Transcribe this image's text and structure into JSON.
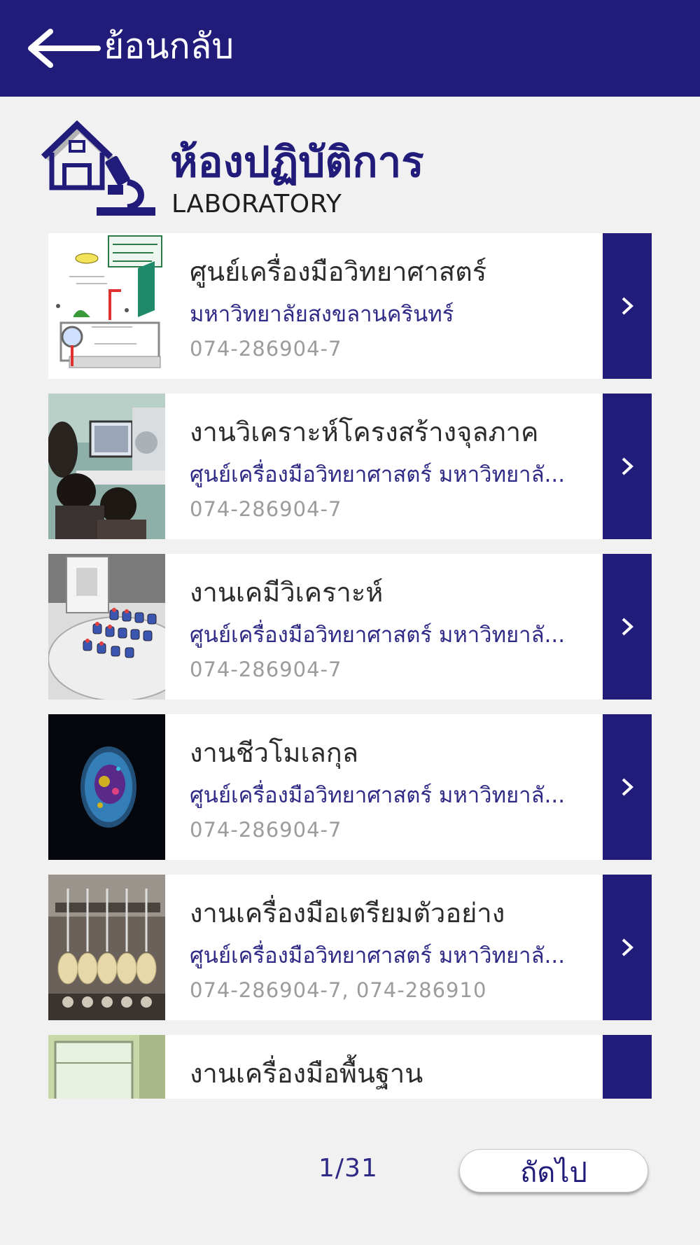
{
  "header": {
    "back_label": "ย้อนกลับ",
    "colors": {
      "bar": "#211c7a",
      "text": "#ffffff"
    }
  },
  "section": {
    "title_th": "ห้องปฏิบัติการ",
    "title_en": "LABORATORY",
    "icon": "house-microscope-icon"
  },
  "items": [
    {
      "title": "ศูนย์เครื่องมือวิทยาศาสตร์",
      "subtitle": "มหาวิทยาลัยสงขลานครินทร์",
      "phone": "074-286904-7",
      "thumb": "campus-map"
    },
    {
      "title": "งานวิเคราะห์โครงสร้างจุลภาค",
      "subtitle": "ศูนย์เครื่องมือวิทยาศาสตร์ มหาวิทยาลั...",
      "phone": "074-286904-7",
      "thumb": "lab-people"
    },
    {
      "title": "งานเคมีวิเคราะห์",
      "subtitle": "ศูนย์เครื่องมือวิทยาศาสตร์ มหาวิทยาลั...",
      "phone": "074-286904-7",
      "thumb": "autosampler"
    },
    {
      "title": "งานชีวโมเลกุล",
      "subtitle": "ศูนย์เครื่องมือวิทยาศาสตร์ มหาวิทยาลั...",
      "phone": "074-286904-7",
      "thumb": "cell"
    },
    {
      "title": "งานเครื่องมือเตรียมตัวอย่าง",
      "subtitle": "ศูนย์เครื่องมือวิทยาศาสตร์ มหาวิทยาลั...",
      "phone": "074-286904-7, 074-286910",
      "thumb": "extraction-apparatus"
    },
    {
      "title": "งานเครื่องมือพื้นฐาน",
      "subtitle": "",
      "phone": "",
      "thumb": "glass-cabinet"
    }
  ],
  "pagination": {
    "current": "1/31",
    "next_label": "ถัดไป"
  },
  "icons": {
    "back": "back-arrow-icon",
    "item_arrow": "chevron-right-icon"
  }
}
